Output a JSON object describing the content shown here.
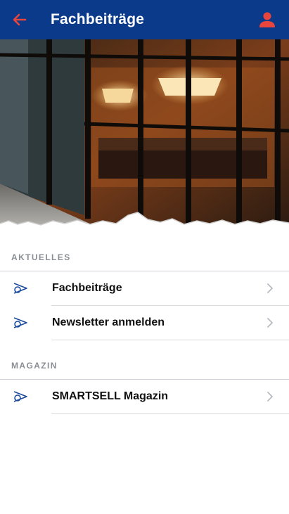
{
  "header": {
    "title": "Fachbeiträge",
    "back_icon": "arrow-left-icon",
    "user_icon": "user-icon",
    "background_color": "#0b3a8b",
    "accent_color": "#e8463c"
  },
  "hero": {
    "image": "restaurant-interior-photo"
  },
  "sections": [
    {
      "label": "AKTUELLES",
      "items": [
        {
          "label": "Fachbeiträge",
          "icon": "brand-logo-icon"
        },
        {
          "label": "Newsletter anmelden",
          "icon": "brand-logo-icon"
        }
      ]
    },
    {
      "label": "MAGAZIN",
      "items": [
        {
          "label": "SMARTSELL Magazin",
          "icon": "brand-logo-icon"
        }
      ]
    }
  ]
}
